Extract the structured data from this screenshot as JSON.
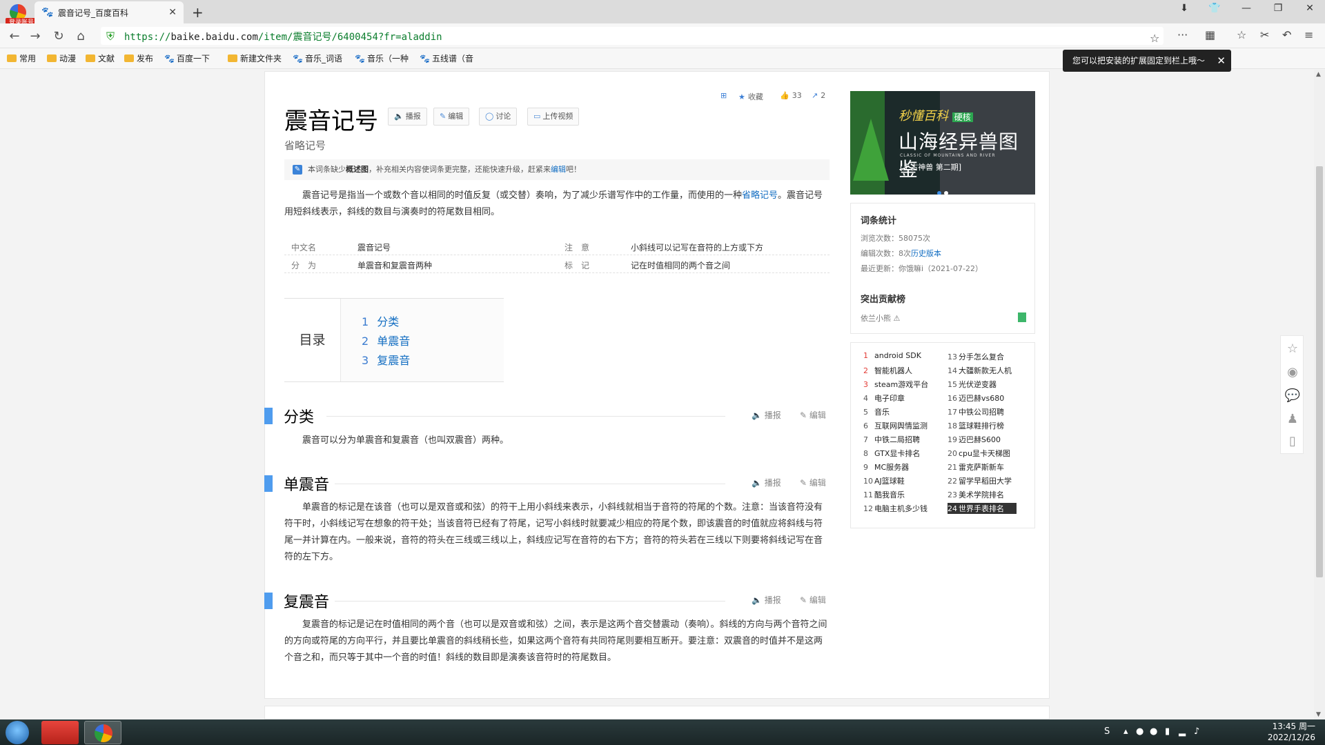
{
  "browser": {
    "login_badge": "登录账号",
    "tab_title": "震音记号_百度百科",
    "url_scheme": "https://",
    "url_host": "baike.baidu.com",
    "url_path": "/item/震音记号/6400454?fr=aladdin",
    "bookmarks": [
      "常用",
      "动漫",
      "文献",
      "发布",
      "百度一下",
      "新建文件夹",
      "音乐_词语",
      "音乐（一种",
      "五线谱（音"
    ],
    "extension_tip": "您可以把安装的扩展固定到栏上哦～",
    "icons": {
      "back": "back-arrow-icon",
      "forward": "forward-arrow-icon",
      "reload": "reload-icon",
      "home": "home-icon",
      "secure": "shield-icon",
      "star": "star-icon",
      "more": "more-icon",
      "extensions": "grid-icon",
      "favorites": "favorites-icon",
      "screenshot": "scissors-icon",
      "undo": "undo-icon",
      "menu": "menu-icon"
    }
  },
  "article": {
    "title": "震音记号",
    "subtitle": "省略记号",
    "title_buttons": [
      "播报",
      "编辑",
      "讨论",
      "上传视频"
    ],
    "top_tools": {
      "collect": "收藏",
      "likes": "33",
      "shares": "2"
    },
    "notice": {
      "prefix": "本词条缺少",
      "bold": "概述图",
      "middle": "，补充相关内容使词条更完整，还能快速升级，赶紧来",
      "link": "编辑",
      "suffix": "吧！"
    },
    "intro": {
      "text1": "震音记号是指当一个或数个音以相同的时值反复（或交替）奏响，为了减少乐谱写作中的工作量，而使用的一种",
      "link": "省略记号",
      "text2": "。震音记号用短斜线表示，斜线的数目与演奏时的符尾数目相同。"
    },
    "basic_info": [
      {
        "name": "中文名",
        "value": "震音记号",
        "name2": "注　意",
        "value2": "小斜线可以记写在音符的上方或下方"
      },
      {
        "name": "分　为",
        "value": "单震音和复震音两种",
        "name2": "标　记",
        "value2": "记在时值相同的两个音之间"
      }
    ],
    "catalog": {
      "label": "目录",
      "items": [
        {
          "num": "1",
          "label": "分类"
        },
        {
          "num": "2",
          "label": "单震音"
        },
        {
          "num": "3",
          "label": "复震音"
        }
      ]
    },
    "section_tool_read": "播报",
    "section_tool_edit": "编辑",
    "sections": [
      {
        "title": "分类",
        "text": "震音可以分为单震音和复震音（也叫双震音）两种。"
      },
      {
        "title": "单震音",
        "text": "单震音的标记是在该音（也可以是双音或和弦）的符干上用小斜线来表示，小斜线就相当于音符的符尾的个数。注意：当该音符没有符干时，小斜线记写在想象的符干处；当该音符已经有了符尾，记写小斜线时就要减少相应的符尾个数，即该震音的时值就应将斜线与符尾一并计算在内。一般来说，音符的符头在三线或三线以上，斜线应记写在音符的右下方；音符的符头若在三线以下则要将斜线记写在音符的左下方。"
      },
      {
        "title": "复震音",
        "text": "复震音的标记是记在时值相同的两个音（也可以是双音或和弦）之间，表示是这两个音交替震动（奏响）。斜线的方向与两个音符之间的方向或符尾的方向平行，并且要比单震音的斜线稍长些，如果这两个音符有共同符尾则要相互断开。要注意：双震音的时值并不是这两个音之和，而只等于其中一个音的时值！斜线的数目即是演奏该音符时的符尾数目。"
      }
    ]
  },
  "sidebar": {
    "banner": {
      "top": "秒懂百科",
      "tag": "硬核",
      "main": "山海经异兽图鉴",
      "en": "CLASSIC OF MOUNTAINS AND RIVER",
      "sub": "[上古神兽 第二期]"
    },
    "stats": {
      "heading": "词条统计",
      "views": "浏览次数：58075次",
      "edits_prefix": "编辑次数：8次",
      "edits_link": "历史版本",
      "updated": "最近更新：你饿嘛i（2021-07-22）",
      "contrib_heading": "突出贡献榜",
      "contributor": "依兰小熊"
    },
    "hot_list": [
      {
        "n": "1",
        "t": "android SDK"
      },
      {
        "n": "2",
        "t": "智能机器人"
      },
      {
        "n": "3",
        "t": "steam游戏平台"
      },
      {
        "n": "4",
        "t": "电子印章"
      },
      {
        "n": "5",
        "t": "音乐"
      },
      {
        "n": "6",
        "t": "互联网舆情监测"
      },
      {
        "n": "7",
        "t": "中铁二局招聘"
      },
      {
        "n": "8",
        "t": "GTX显卡排名"
      },
      {
        "n": "9",
        "t": "MC服务器"
      },
      {
        "n": "10",
        "t": "AJ篮球鞋"
      },
      {
        "n": "11",
        "t": "酷我音乐"
      },
      {
        "n": "12",
        "t": "电脑主机多少钱"
      },
      {
        "n": "13",
        "t": "分手怎么复合"
      },
      {
        "n": "14",
        "t": "大疆新款无人机"
      },
      {
        "n": "15",
        "t": "光伏逆变器"
      },
      {
        "n": "16",
        "t": "迈巴赫vs680"
      },
      {
        "n": "17",
        "t": "中铁公司招聘"
      },
      {
        "n": "18",
        "t": "篮球鞋排行榜"
      },
      {
        "n": "19",
        "t": "迈巴赫S600"
      },
      {
        "n": "20",
        "t": "cpu显卡天梯图"
      },
      {
        "n": "21",
        "t": "雷克萨斯新车"
      },
      {
        "n": "22",
        "t": "留学早稻田大学"
      },
      {
        "n": "23",
        "t": "美术学院排名"
      },
      {
        "n": "24",
        "t": "世界手表排名"
      }
    ]
  },
  "float_tools": [
    "star-icon",
    "weibo-icon",
    "wechat-icon",
    "qq-icon",
    "mobile-icon"
  ],
  "taskbar": {
    "time": "13:45 周一",
    "date": "2022/12/26"
  },
  "colors": {
    "link": "#136ec2",
    "section_bar": "#4f9cee",
    "hot_top": "#e23b35"
  }
}
